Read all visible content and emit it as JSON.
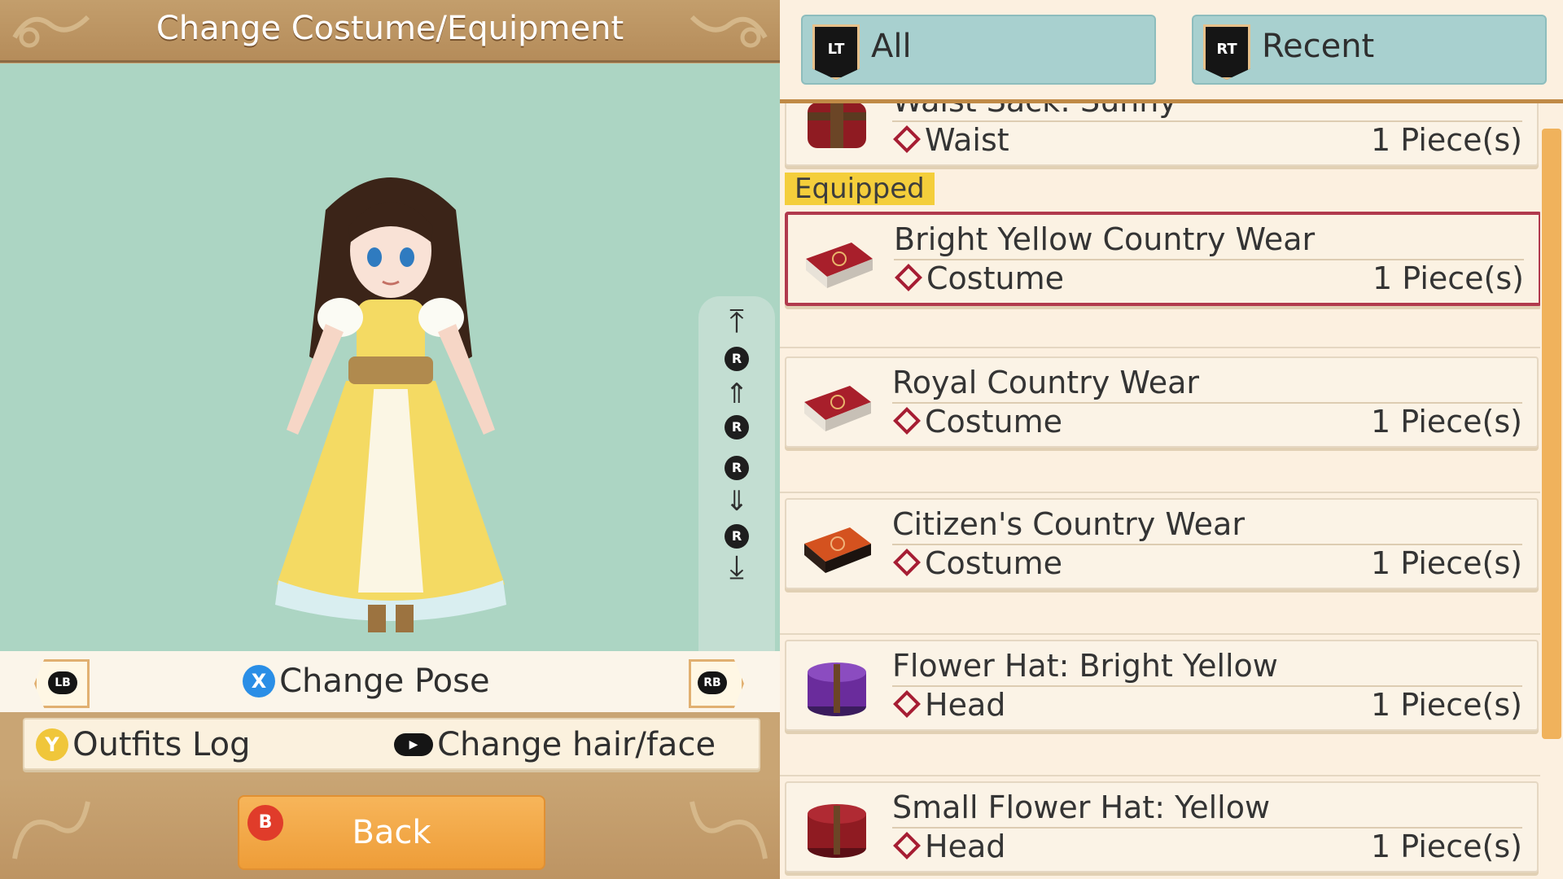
{
  "left_panel": {
    "title": "Change Costume/Equipment",
    "lb_label": "LB",
    "rb_label": "RB",
    "x_button": "X",
    "change_pose": "Change Pose",
    "y_button": "Y",
    "outfits_log": "Outfits Log",
    "change_hair_face": "Change hair/face",
    "b_button": "B",
    "back": "Back",
    "camera_r": "R"
  },
  "filters": {
    "all": {
      "tag": "LT",
      "label": "All"
    },
    "recent": {
      "tag": "RT",
      "label": "Recent"
    }
  },
  "equipped_label": "Equipped",
  "items": [
    {
      "name": "Waist Sack: Sunny",
      "slot": "Waist",
      "qty": "1 Piece(s)",
      "icon": "red-bag-icon"
    },
    {
      "name": "Bright Yellow Country Wear",
      "slot": "Costume",
      "qty": "1 Piece(s)",
      "icon": "red-costume-box-icon",
      "equipped": true
    },
    {
      "name": "Royal Country Wear",
      "slot": "Costume",
      "qty": "1 Piece(s)",
      "icon": "red-costume-box-icon"
    },
    {
      "name": "Citizen's Country Wear",
      "slot": "Costume",
      "qty": "1 Piece(s)",
      "icon": "orange-costume-box-icon"
    },
    {
      "name": "Flower Hat: Bright Yellow",
      "slot": "Head",
      "qty": "1 Piece(s)",
      "icon": "purple-hatbox-icon"
    },
    {
      "name": "Small Flower Hat: Yellow",
      "slot": "Head",
      "qty": "1 Piece(s)",
      "icon": "red-hatbox-icon"
    }
  ],
  "colors": {
    "preview_bg": "#acd5c3",
    "equipped_border": "#b13a4d",
    "back_button": "#f0a33f",
    "filter_button": "#a8d0cf"
  }
}
